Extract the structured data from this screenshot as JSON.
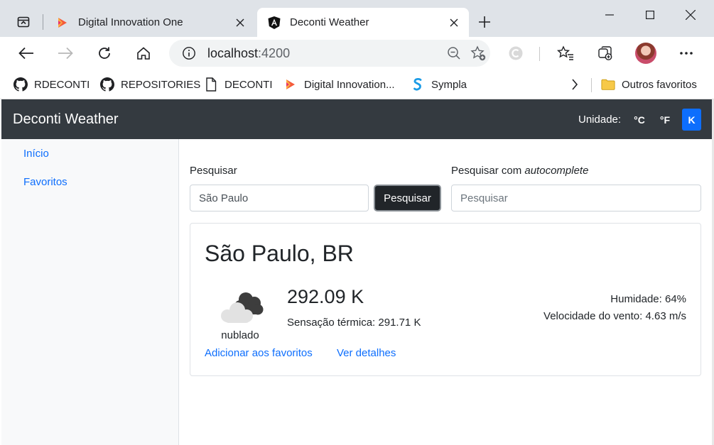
{
  "browser": {
    "tabs": [
      {
        "title": "Digital Innovation One",
        "favicon": "dio-icon",
        "active": false
      },
      {
        "title": "Deconti Weather",
        "favicon": "angular-icon",
        "active": true
      }
    ],
    "url_host": "localhost",
    "url_port": ":4200",
    "bookmarks": [
      {
        "label": "RDECONTI",
        "icon": "github-icon"
      },
      {
        "label": "REPOSITORIES",
        "icon": "github-icon"
      },
      {
        "label": "DECONTI",
        "icon": "page-icon"
      },
      {
        "label": "Digital Innovation...",
        "icon": "dio-icon"
      },
      {
        "label": "Sympla",
        "icon": "sympla-icon"
      }
    ],
    "other_favorites": "Outros favoritos"
  },
  "app": {
    "brand": "Deconti Weather",
    "unit_label": "Unidade:",
    "units": {
      "c": "°C",
      "f": "°F",
      "k": "K"
    },
    "selected_unit": "K",
    "accent_color": "#0d6efd"
  },
  "sidebar": {
    "items": [
      {
        "label": "Início"
      },
      {
        "label": "Favoritos"
      }
    ]
  },
  "search": {
    "label": "Pesquisar",
    "value": "São Paulo",
    "button": "Pesquisar",
    "auto_label_prefix": "Pesquisar com ",
    "auto_label_em": "autocomplete",
    "auto_placeholder": "Pesquisar"
  },
  "weather": {
    "city": "São Paulo, BR",
    "condition": "nublado",
    "condition_icon": "cloudy-icon",
    "temperature": "292.09 K",
    "feels_like": "Sensação térmica: 291.71 K",
    "humidity": "Humidade: 64%",
    "wind": "Velocidade do vento: 4.63 m/s",
    "add_favorite": "Adicionar aos favoritos",
    "details": "Ver detalhes"
  }
}
